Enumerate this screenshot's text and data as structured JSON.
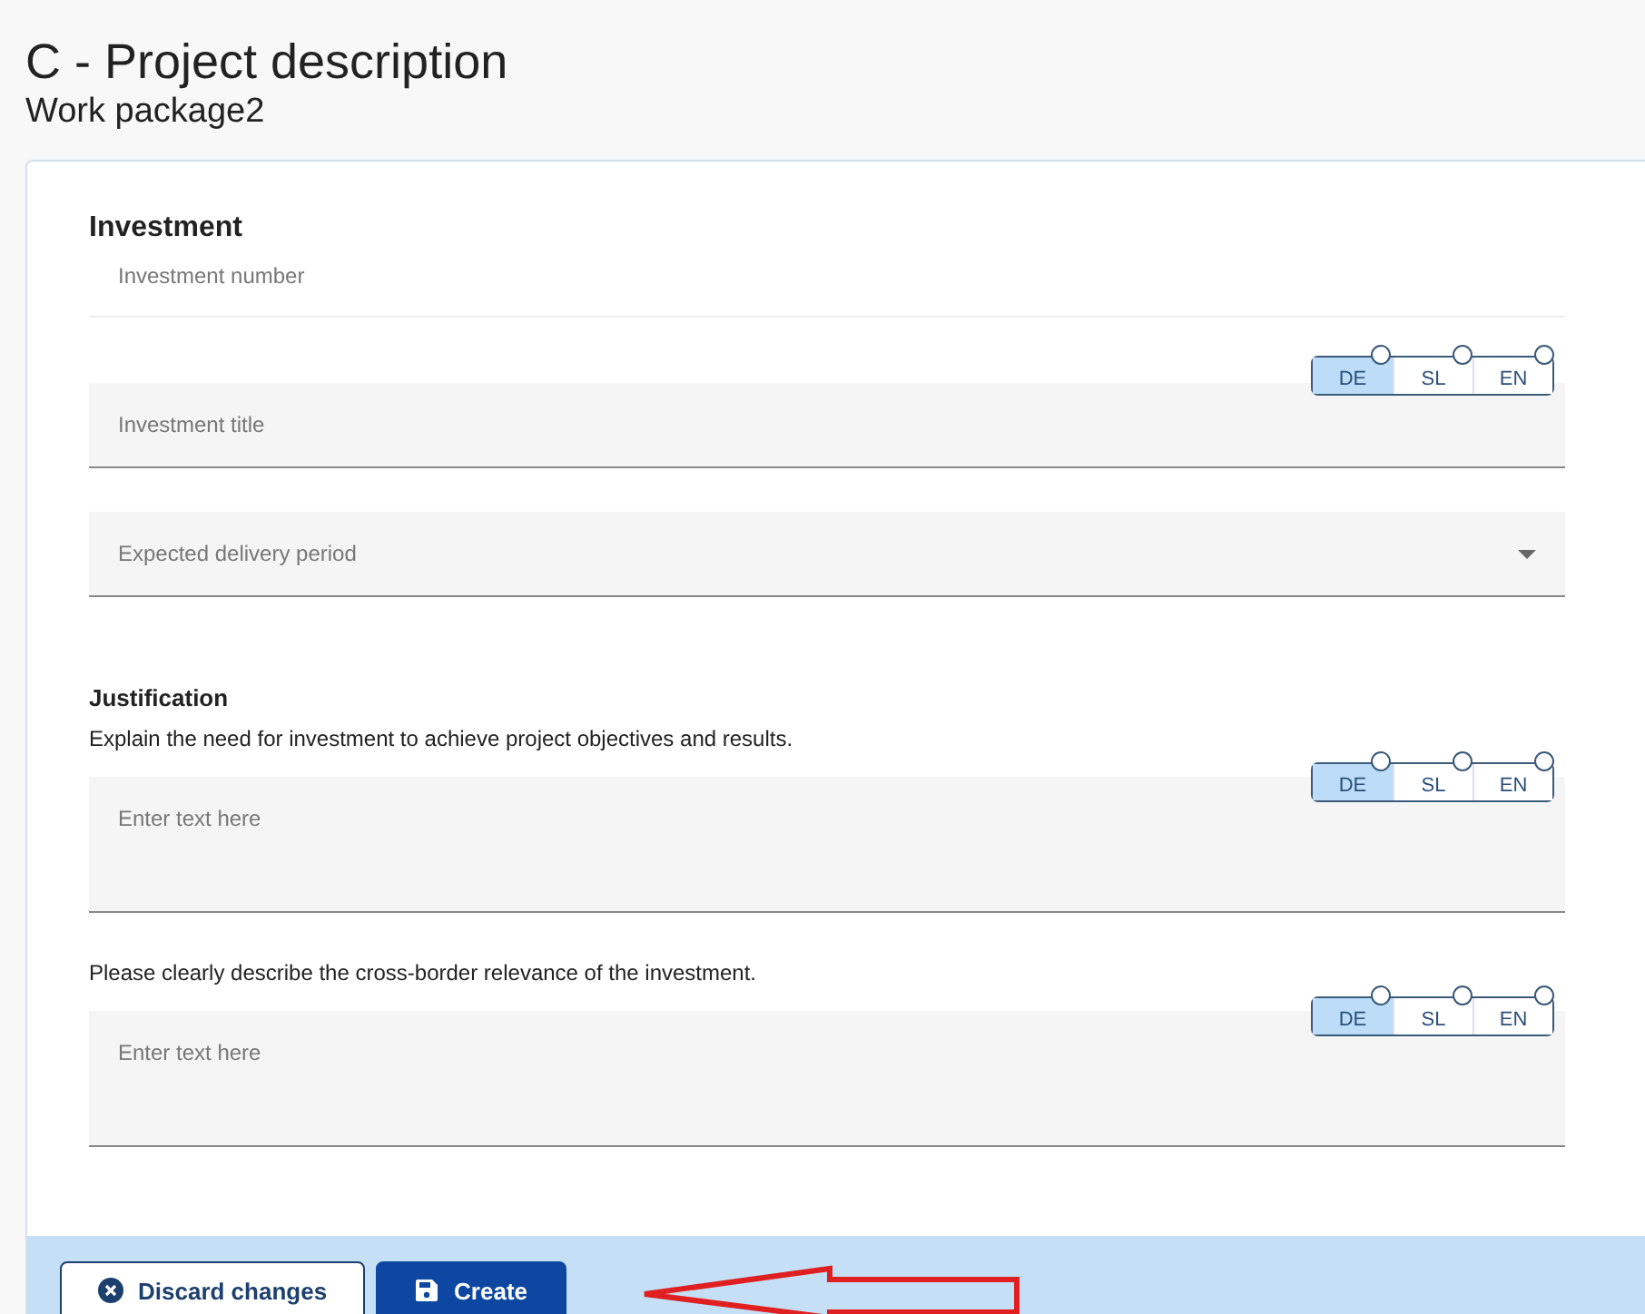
{
  "header": {
    "title": "C - Project description",
    "subtitle": "Work package2"
  },
  "section": {
    "title": "Investment",
    "fields": [
      {
        "kind": "plain",
        "placeholder": "Investment number"
      },
      {
        "kind": "text",
        "placeholder": "Investment title",
        "languages": [
          {
            "label": "DE",
            "selected": true
          },
          {
            "label": "SL",
            "selected": false
          },
          {
            "label": "EN",
            "selected": false
          }
        ]
      },
      {
        "kind": "select",
        "placeholder": "Expected delivery period"
      }
    ]
  },
  "justification": {
    "title": "Justification",
    "questions": [
      {
        "prompt": "Explain the need for investment to achieve project objectives and results.",
        "placeholder": "Enter text here",
        "languages": [
          {
            "label": "DE",
            "selected": true
          },
          {
            "label": "SL",
            "selected": false
          },
          {
            "label": "EN",
            "selected": false
          }
        ]
      },
      {
        "prompt": "Please clearly describe the cross-border relevance of the investment.",
        "placeholder": "Enter text here",
        "languages": [
          {
            "label": "DE",
            "selected": true
          },
          {
            "label": "SL",
            "selected": false
          },
          {
            "label": "EN",
            "selected": false
          }
        ]
      }
    ]
  },
  "footer": {
    "buttons": [
      {
        "kind": "secondary",
        "label": "Discard changes"
      },
      {
        "kind": "primary",
        "label": "Create"
      }
    ]
  }
}
